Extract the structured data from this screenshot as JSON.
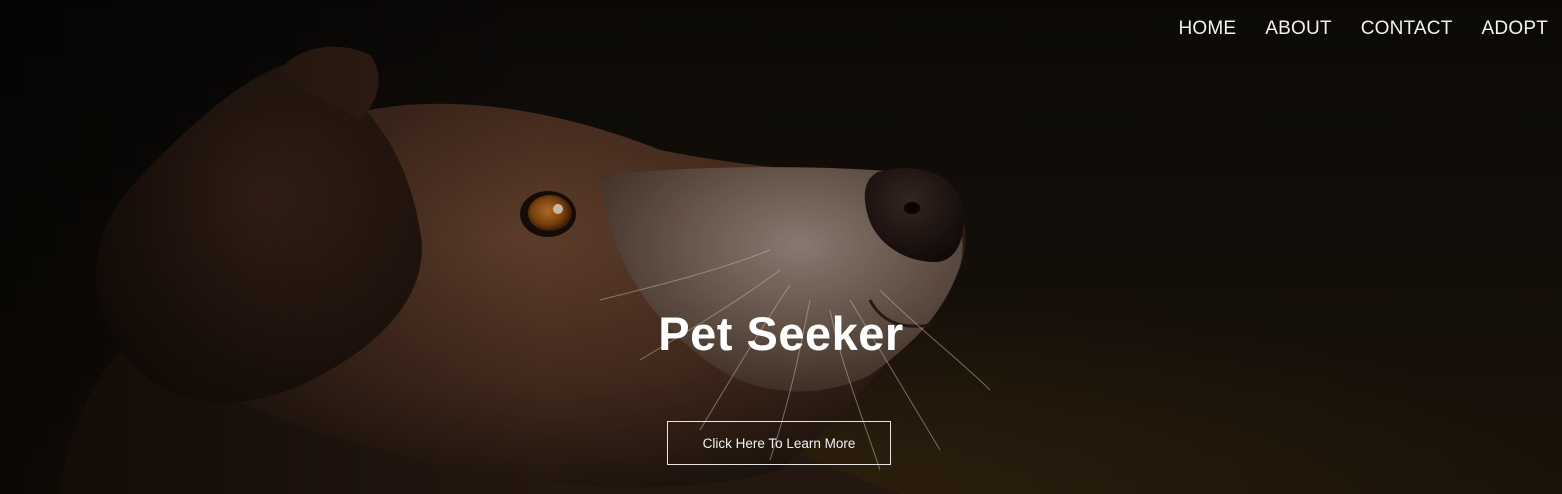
{
  "nav": {
    "items": [
      {
        "label": "HOME"
      },
      {
        "label": "ABOUT"
      },
      {
        "label": "CONTACT"
      },
      {
        "label": "ADOPT"
      }
    ]
  },
  "hero": {
    "title": "Pet Seeker",
    "cta_label": "Click Here To Learn More",
    "image_subject": "dog-profile-photo"
  },
  "colors": {
    "background": "#0f0c08",
    "text": "#ffffff",
    "fur": "#5a3a28",
    "eye": "#8a4a12"
  }
}
